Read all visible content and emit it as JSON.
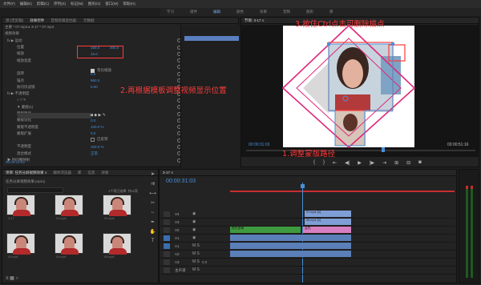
{
  "menu": [
    "文件(F)",
    "编辑(E)",
    "剪辑(C)",
    "序列(S)",
    "标记(M)",
    "图形(G)",
    "窗口(W)",
    "帮助(H)"
  ],
  "workspaces": [
    "学习",
    "组件",
    "编辑",
    "颜色",
    "效果",
    "音频",
    "图形",
    "库"
  ],
  "workspace_active": "编辑",
  "effect_panel": {
    "tabs": [
      "源:(无剪辑)",
      "效果控件",
      "音频剪辑混合器:",
      "元数据"
    ],
    "clip_header": "主要 * 07.mp4 ▸ 3-17 * 07.mp4",
    "section_video": "视频效果",
    "rows": [
      {
        "label": "fx ▶ 运动",
        "v1": "",
        "v2": ""
      },
      {
        "label": "位置",
        "v1": "160.0",
        "v2": "300.0"
      },
      {
        "label": "缩放",
        "v1": "15.0",
        "v2": ""
      },
      {
        "label": "缩放宽度",
        "v1": "",
        "v2": ""
      },
      {
        "label": "",
        "v1": "",
        "v2": ""
      },
      {
        "label": "旋转",
        "v1": "0.0",
        "v2": ""
      },
      {
        "label": "锚点",
        "v1": "960.0",
        "v2": ""
      },
      {
        "label": "防闪烁滤镜",
        "v1": "0.00",
        "v2": ""
      },
      {
        "label": "fx ▶ 不透明度",
        "v1": "",
        "v2": ""
      },
      {
        "label": "○ □ ✎",
        "v1": "",
        "v2": ""
      },
      {
        "label": "▼ 蒙版(1)",
        "v1": "",
        "v2": ""
      },
      {
        "label": "蒙版路径",
        "v1": "",
        "v2": ""
      },
      {
        "label": "蒙版羽化",
        "v1": "0.0",
        "v2": ""
      },
      {
        "label": "蒙版不透明度",
        "v1": "100.0 %",
        "v2": ""
      },
      {
        "label": "蒙版扩展",
        "v1": "0.0",
        "v2": ""
      },
      {
        "label": "",
        "v1": "",
        "v2": ""
      },
      {
        "label": "不透明度",
        "v1": "100.0 %",
        "v2": ""
      },
      {
        "label": "混合模式",
        "v1": "正常",
        "v2": ""
      },
      {
        "label": "▶ 时间重映射",
        "v1": "",
        "v2": ""
      }
    ],
    "uniform_scale": "等比缩放",
    "inverted": "已反转",
    "timecode": "00:00:31:03"
  },
  "program_monitor": {
    "title": "节目: 3-17 ≡",
    "timecode_left": "00:00:31:03",
    "timecode_right": "00:00:51:16",
    "fit_label": "完整"
  },
  "project_panel": {
    "tabs": [
      "项目: 任务分屏视频效果 ≡",
      "媒体浏览器",
      "库",
      "信息",
      "效果"
    ],
    "file": "任务分屏视频效果.prproj",
    "count": "1个项已选择, 共11项",
    "items": [
      "3-17",
      "01.mp4",
      "02.mp4",
      "03.mp4",
      "04.mp4",
      "05.mp4"
    ]
  },
  "timeline": {
    "tab": "3-17 ≡",
    "timecode": "00:00:31:03",
    "tracks": [
      "V4",
      "V3",
      "V2",
      "V1",
      "A1",
      "A2",
      "A3",
      "主声道"
    ],
    "clips": [
      {
        "label": "07.mp4 [V]"
      },
      {
        "label": "06.mp4 [V]"
      },
      {
        "label": "蓝色"
      },
      {
        "label": "颜色遮罩"
      },
      {
        "label": ""
      }
    ],
    "master_value": "0.0"
  },
  "annotations": {
    "step1": "1.调整蒙版路径",
    "step2": "2.再根据模板调整视频显示位置",
    "step3": "3.按住Ctrl点击可删除描点"
  },
  "colors": {
    "accent": "#4a8fd8",
    "annotation": "#ff3b3b",
    "mask_line": "#e0287a",
    "clip_blue": "#7f9ed6",
    "clip_green": "#3e9a3e",
    "clip_pink": "#d77fc0",
    "clip_audio": "#5b7fb8"
  }
}
